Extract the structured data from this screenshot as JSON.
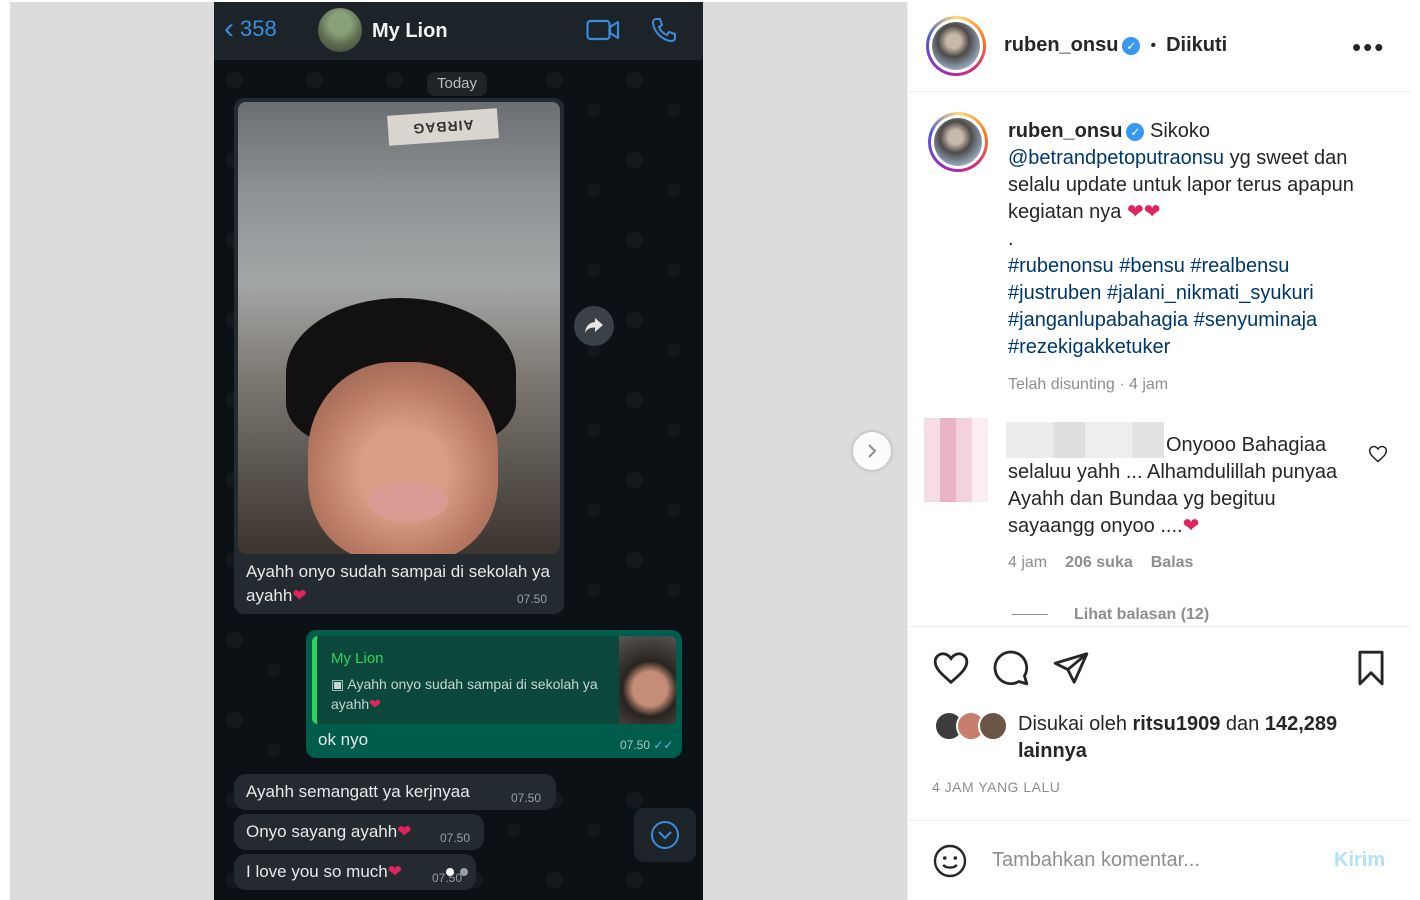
{
  "media": {
    "chat": {
      "back_count": "358",
      "contact_name": "My Lion",
      "date_chip": "Today",
      "airbag_text": "AIRBAG",
      "img_caption": "Ayahh onyo sudah sampai di sekolah ya ayahh",
      "img_time": "07.50",
      "reply_quote_name": "My Lion",
      "reply_quote_text": "Ayahh onyo sudah sampai di sekolah ya ayahh",
      "reply_text": "ok nyo",
      "reply_time": "07.50",
      "msg1": "Ayahh semangatt ya kerjnyaa",
      "msg1_time": "07.50",
      "msg2": "Onyo sayang ayahh",
      "msg2_time": "07.50",
      "msg3": "I love you so much",
      "msg3_time": "07.50"
    },
    "carousel_dots": 2,
    "carousel_active": 0
  },
  "post": {
    "header": {
      "username": "ruben_onsu",
      "separator": "•",
      "follow_state": "Diikuti"
    },
    "caption": {
      "username": "ruben_onsu",
      "text_before": "Sikoko",
      "mention": "@betrandpetoputraonsu",
      "text_after": "yg sweet dan selalu update untuk lapor terus apapun kegiatan nya",
      "dot": ".",
      "hashtags": "#rubenonsu #bensu #realbensu #justruben #jalani_nikmati_syukuri #janganlupabahagia #senyuminaja #rezekigakketuker",
      "edited": "Telah disunting",
      "time": "4 jam"
    },
    "comment": {
      "text": "Onyooo Bahagiaa selaluu yahh ... Alhamdulillah punyaa Ayahh dan Bundaa yg begituu sayaangg onyoo ....",
      "time": "4 jam",
      "likes": "206 suka",
      "reply": "Balas",
      "view_replies": "Lihat balasan (12)"
    },
    "likes": {
      "prefix": "Disukai oleh",
      "user": "ritsu1909",
      "conj": "dan",
      "count": "142,289 lainnya"
    },
    "posted_ago": "4 JAM YANG LALU",
    "comment_box": {
      "placeholder": "Tambahkan komentar...",
      "post_label": "Kirim"
    }
  },
  "colors": {
    "wa_bubble_in": "#232b31",
    "wa_bubble_out": "#005c4b",
    "ig_link": "#00376b",
    "ig_blue": "#3897f0",
    "heart_red": "#e0245e"
  }
}
